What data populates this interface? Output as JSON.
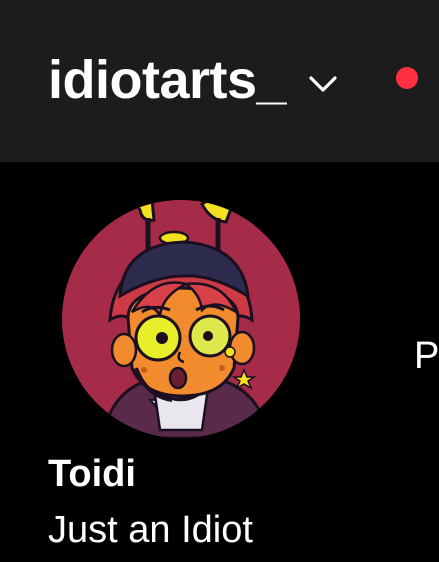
{
  "header": {
    "username": "idiotarts_",
    "dropdown_icon": "chevron-down-icon",
    "notification_color": "#ff3040"
  },
  "profile": {
    "display_name": "Toidi",
    "bio": "Just an Idiot",
    "stat_peek": "P"
  },
  "colors": {
    "header_bg": "#1c1c1c",
    "page_bg": "#000000",
    "avatar_bg": "#a52b48"
  }
}
